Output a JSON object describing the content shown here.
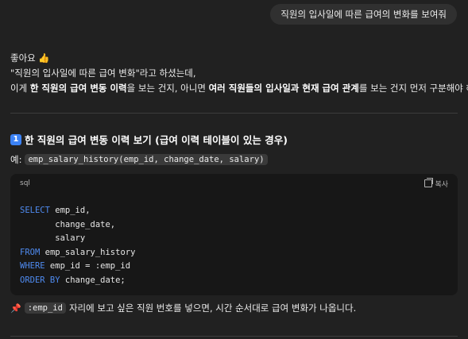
{
  "user_message": "직원의 입사일에 따른 급여의 변화를 보여줘",
  "reply": {
    "greeting": "좋아요",
    "greeting_emoji": "👍",
    "line2": "\"직원의 입사일에 따른 급여 변화\"라고 하셨는데,",
    "line3": {
      "t1": "이게 ",
      "b1": "한 직원의 급여 변동 이력",
      "t2": "을 보는 건지, 아니면 ",
      "b2": "여러 직원들의 입사일과 현재 급여 관계",
      "t3": "를 보는 건지 먼저 구분해야 해요."
    },
    "section_number": "1",
    "section_title": "한 직원의 급여 변동 이력 보기 (급여 이력 테이블이 있는 경우)",
    "example_label": "예:",
    "example_code": "emp_salary_history(emp_id, change_date, salary)",
    "code_block": {
      "language": "sql",
      "copy_label": "복사",
      "lines": [
        {
          "kw": "SELECT",
          "rest": " emp_id,"
        },
        {
          "kw": "",
          "rest": "       change_date,"
        },
        {
          "kw": "",
          "rest": "       salary"
        },
        {
          "kw": "FROM",
          "rest": " emp_salary_history"
        },
        {
          "kw": "WHERE",
          "rest": " emp_id = :emp_id"
        },
        {
          "kw": "ORDER BY",
          "rest": " change_date;"
        }
      ]
    },
    "note_emoji": "📌",
    "note_code": ":emp_id",
    "note_text": "자리에 보고 싶은 직원 번호를 넣으면, 시간 순서대로 급여 변화가 나옵니다."
  }
}
